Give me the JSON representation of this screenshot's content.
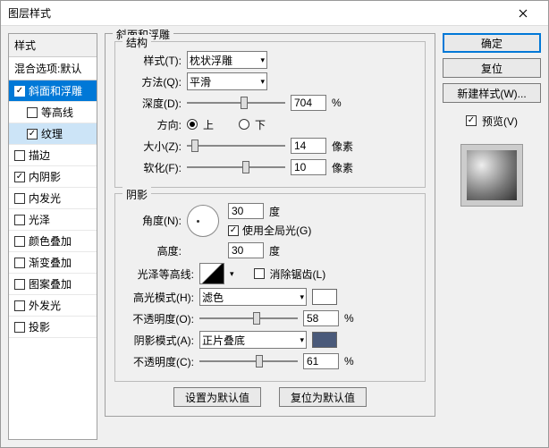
{
  "window": {
    "title": "图层样式"
  },
  "styles": {
    "header": "样式",
    "blendDefault": "混合选项:默认",
    "items": [
      {
        "label": "斜面和浮雕",
        "checked": true,
        "selected": true
      },
      {
        "label": "等高线",
        "checked": false,
        "sub": true
      },
      {
        "label": "纹理",
        "checked": true,
        "sub": true,
        "selsub": true
      },
      {
        "label": "描边",
        "checked": false
      },
      {
        "label": "内阴影",
        "checked": true
      },
      {
        "label": "内发光",
        "checked": false
      },
      {
        "label": "光泽",
        "checked": false
      },
      {
        "label": "颜色叠加",
        "checked": false
      },
      {
        "label": "渐变叠加",
        "checked": false
      },
      {
        "label": "图案叠加",
        "checked": false
      },
      {
        "label": "外发光",
        "checked": false
      },
      {
        "label": "投影",
        "checked": false
      }
    ]
  },
  "panel": {
    "title": "斜面和浮雕",
    "structure": {
      "legend": "结构",
      "styleLabel": "样式(T):",
      "styleValue": "枕状浮雕",
      "methodLabel": "方法(Q):",
      "methodValue": "平滑",
      "depthLabel": "深度(D):",
      "depthValue": "704",
      "depthUnit": "%",
      "depthPos": 58,
      "dirLabel": "方向:",
      "dirUp": "上",
      "dirDown": "下",
      "sizeLabel": "大小(Z):",
      "sizeValue": "14",
      "sizeUnit": "像素",
      "sizePos": 8,
      "softenLabel": "软化(F):",
      "softenValue": "10",
      "softenUnit": "像素",
      "softenPos": 60
    },
    "shadow": {
      "legend": "阴影",
      "angleLabel": "角度(N):",
      "angleValue": "30",
      "angleUnit": "度",
      "globalLabel": "使用全局光(G)",
      "globalChecked": true,
      "altLabel": "高度:",
      "altValue": "30",
      "altUnit": "度",
      "glossLabel": "光泽等高线:",
      "antiLabel": "消除锯齿(L)",
      "antiChecked": false,
      "hiModeLabel": "高光模式(H):",
      "hiModeValue": "滤色",
      "hiColor": "#ffffff",
      "hiOpLabel": "不透明度(O):",
      "hiOpValue": "58",
      "hiOpUnit": "%",
      "hiOpPos": 58,
      "shModeLabel": "阴影模式(A):",
      "shModeValue": "正片叠底",
      "shColor": "#4a5a7a",
      "shOpLabel": "不透明度(C):",
      "shOpValue": "61",
      "shOpUnit": "%",
      "shOpPos": 61
    },
    "resetDefault": "设置为默认值",
    "restoreDefault": "复位为默认值"
  },
  "right": {
    "ok": "确定",
    "cancel": "复位",
    "newStyle": "新建样式(W)...",
    "previewLabel": "预览(V)",
    "previewChecked": true
  }
}
